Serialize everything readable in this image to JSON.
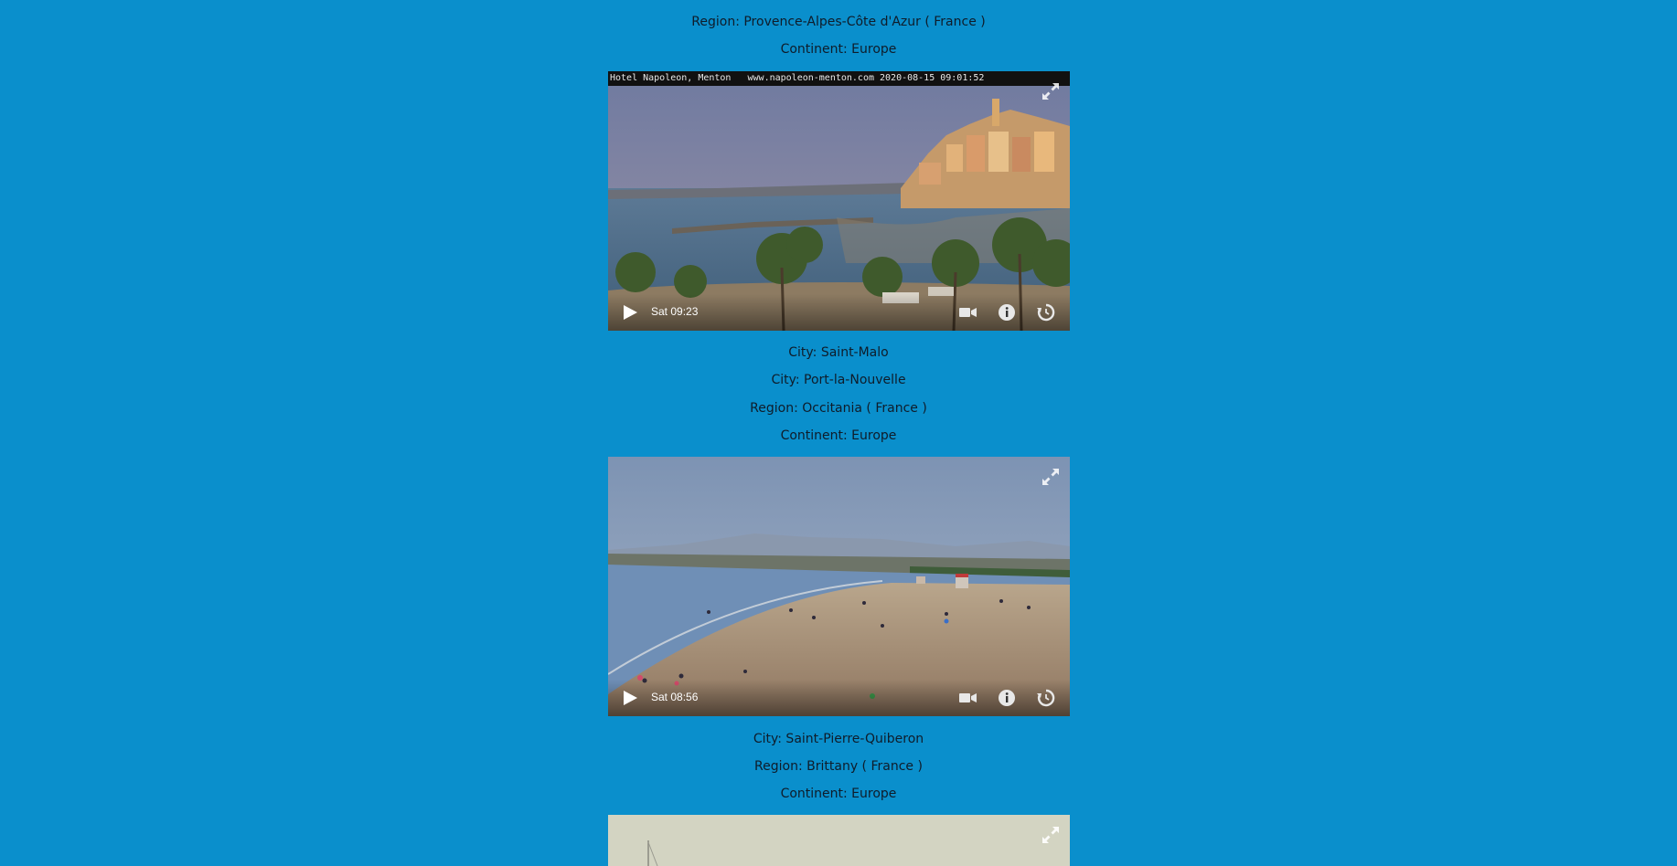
{
  "entries": [
    {
      "lines": [
        "Region: Provence-Alpes-Côte d'Azur ( France )",
        "Continent: Europe"
      ],
      "cam": {
        "overlay": "Hotel Napoleon, Menton   www.napoleon-menton.com 2020-08-15 09:01:52",
        "time": "Sat 09:23"
      }
    },
    {
      "lines": [
        "City: Saint-Malo",
        "City: Port-la-Nouvelle",
        "Region: Occitania ( France )",
        "Continent: Europe"
      ],
      "cam": {
        "time": "Sat 08:56"
      }
    },
    {
      "lines": [
        "City: Saint-Pierre-Quiberon",
        "Region: Brittany ( France )",
        "Continent: Europe"
      ]
    }
  ],
  "icons": {
    "expand": "expand-icon",
    "play": "play-icon",
    "video": "video-camera-icon",
    "info": "info-icon",
    "replay": "replay-icon"
  },
  "colors": {
    "page_background": "#0a8fcc",
    "text": "#0f1c2a"
  }
}
